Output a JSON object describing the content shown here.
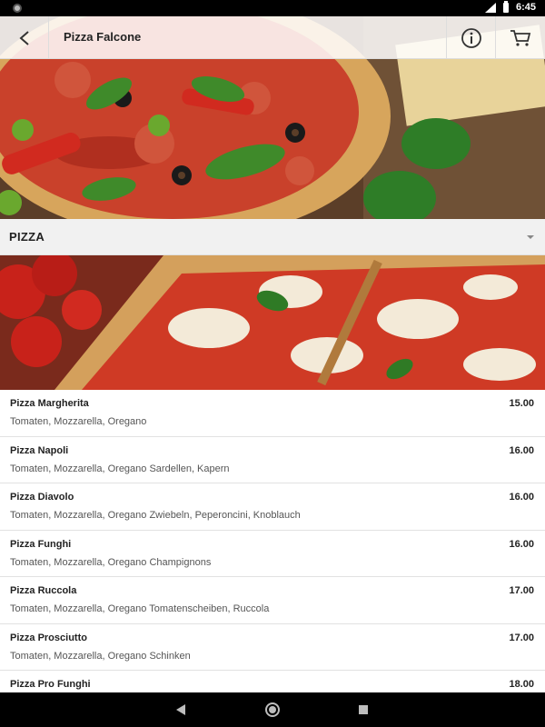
{
  "status_bar": {
    "time": "6:45",
    "network": "LTE"
  },
  "app_bar": {
    "title": "Pizza Falcone"
  },
  "category": {
    "title": "PIZZA"
  },
  "menu_items": [
    {
      "name": "Pizza Margherita",
      "description": "Tomaten, Mozzarella, Oregano",
      "price": "15.00"
    },
    {
      "name": "Pizza Napoli",
      "description": "Tomaten, Mozzarella, Oregano Sardellen, Kapern",
      "price": "16.00"
    },
    {
      "name": "Pizza Diavolo",
      "description": "Tomaten, Mozzarella, Oregano Zwiebeln, Peperoncini, Knoblauch",
      "price": "16.00"
    },
    {
      "name": "Pizza Funghi",
      "description": "Tomaten, Mozzarella, Oregano Champignons",
      "price": "16.00"
    },
    {
      "name": "Pizza Ruccola",
      "description": "Tomaten, Mozzarella, Oregano Tomatenscheiben, Ruccola",
      "price": "17.00"
    },
    {
      "name": "Pizza Prosciutto",
      "description": "Tomaten, Mozzarella, Oregano Schinken",
      "price": "17.00"
    },
    {
      "name": "Pizza Pro Funghi",
      "description": "",
      "price": "18.00"
    }
  ],
  "icons": {
    "back": "back-arrow-icon",
    "info": "info-icon",
    "cart": "cart-icon",
    "category_toggle": "caret-down-icon"
  }
}
